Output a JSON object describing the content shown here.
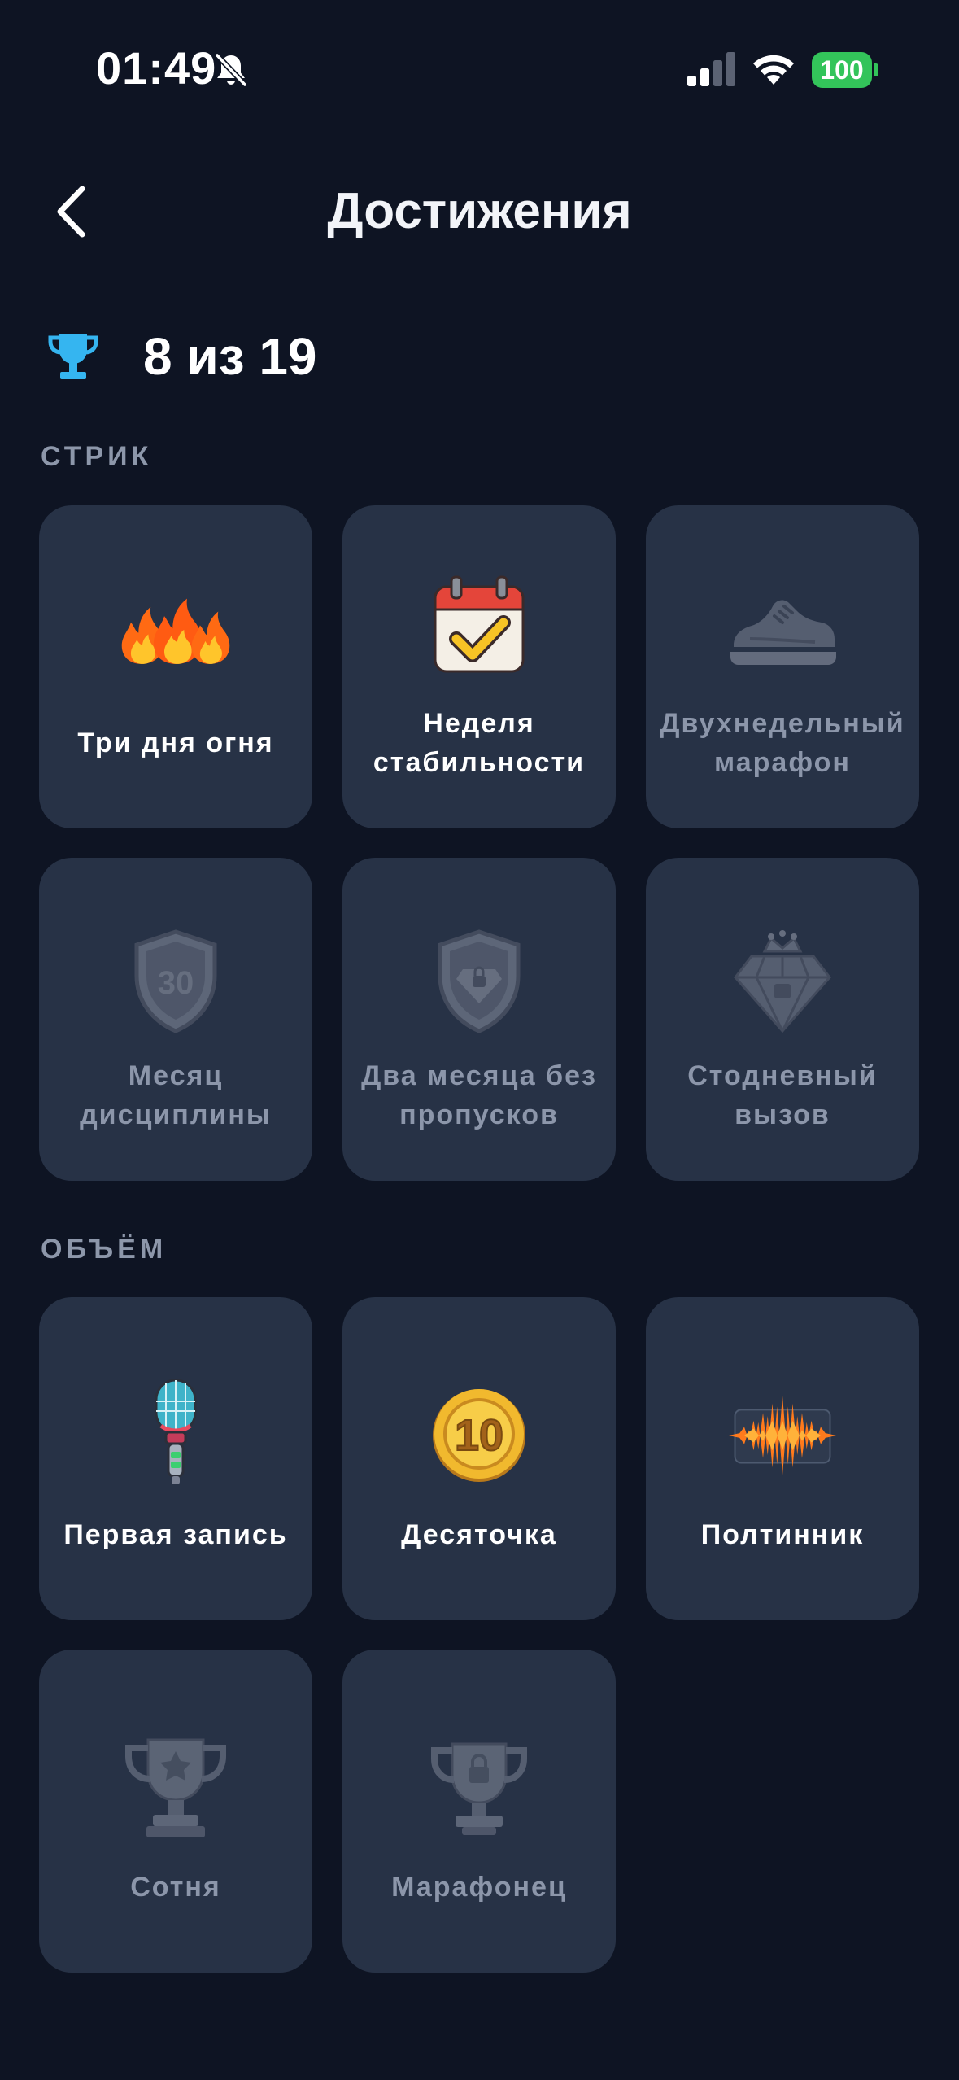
{
  "status_bar": {
    "time": "01:49",
    "battery": "100"
  },
  "header": {
    "title": "Достижения"
  },
  "summary": {
    "text": "8 из 19"
  },
  "sections": [
    {
      "title": "СТРИК",
      "items": [
        {
          "label": "Три дня огня",
          "unlocked": true,
          "icon": "three-flames-icon"
        },
        {
          "label": "Неделя стабильности",
          "unlocked": true,
          "icon": "calendar-check-icon"
        },
        {
          "label": "Двухнедельный марафон",
          "unlocked": false,
          "icon": "sneaker-icon"
        },
        {
          "label": "Месяц дисциплины",
          "unlocked": false,
          "icon": "shield-30-icon"
        },
        {
          "label": "Два месяца без пропусков",
          "unlocked": false,
          "icon": "shield-gem-icon"
        },
        {
          "label": "Стодневный вызов",
          "unlocked": false,
          "icon": "diamond-crown-icon"
        }
      ]
    },
    {
      "title": "ОБЪЁМ",
      "items": [
        {
          "label": "Первая запись",
          "unlocked": true,
          "icon": "microphone-icon"
        },
        {
          "label": "Десяточка",
          "unlocked": true,
          "icon": "gold-coin-10-icon"
        },
        {
          "label": "Полтинник",
          "unlocked": true,
          "icon": "sound-wave-icon"
        },
        {
          "label": "Сотня",
          "unlocked": false,
          "icon": "trophy-star-icon"
        },
        {
          "label": "Марафонец",
          "unlocked": false,
          "icon": "trophy-lock-icon"
        }
      ]
    }
  ],
  "colors": {
    "background": "#0e1423",
    "card": "#273246",
    "accent": "#35b5f0",
    "locked_text": "#8c96aa",
    "battery": "#33c45a"
  }
}
